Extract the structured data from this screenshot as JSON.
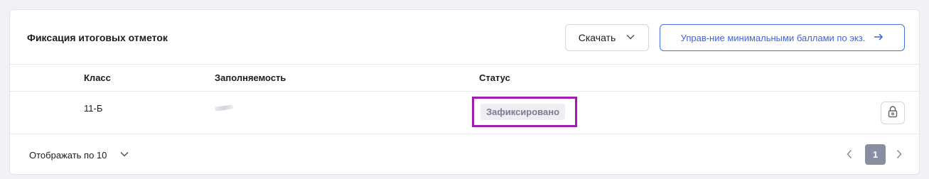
{
  "card": {
    "title": "Фиксация итоговых отметок",
    "download_button": "Скачать",
    "manage_button": "Управ-ние минимальными баллами по экз."
  },
  "table": {
    "headers": [
      "Класс",
      "Заполняемость",
      "Статус"
    ],
    "rows": [
      {
        "class": "11-Б",
        "status": "Зафиксировано"
      }
    ]
  },
  "footer": {
    "page_size_label": "Отображать по 10",
    "current_page": "1"
  },
  "icons": {
    "download_dropdown": "chevron-down-icon",
    "manage_arrow": "arrow-right-icon",
    "row_action": "lock-icon",
    "page_size_dropdown": "chevron-down-icon",
    "prev": "chevron-left-icon",
    "next": "chevron-right-icon"
  },
  "colors": {
    "accent": "#3f63e0",
    "highlight_frame": "#a21caf",
    "active_page": "#8a8ea3",
    "status_badge_bg": "#eeeef3"
  }
}
